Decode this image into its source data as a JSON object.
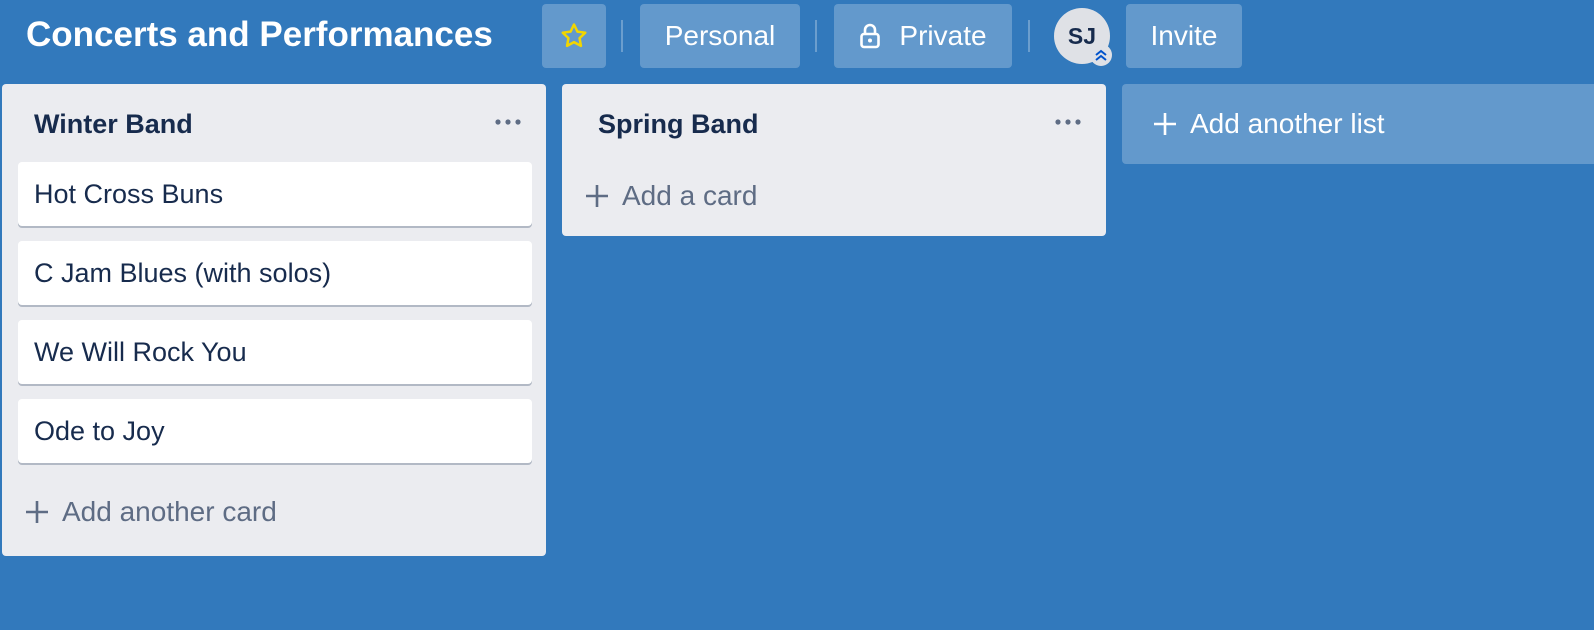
{
  "header": {
    "board_title": "Concerts and Performances",
    "star_icon": "star-icon",
    "personal_label": "Personal",
    "private_label": "Private",
    "lock_icon": "lock-icon",
    "avatar_initials": "SJ",
    "invite_label": "Invite"
  },
  "lists": [
    {
      "title": "Winter Band",
      "cards": [
        "Hot Cross Buns",
        "C Jam Blues (with solos)",
        "We Will Rock You",
        "Ode to Joy"
      ],
      "add_label": "Add another card"
    },
    {
      "title": "Spring Band",
      "cards": [],
      "add_label": "Add a card"
    }
  ],
  "add_list_label": "Add another list",
  "colors": {
    "board_background": "#3279BC",
    "list_background": "#EBECF0",
    "card_text": "#172B4D",
    "muted_text": "#5E6C84",
    "star": "#F2D600"
  }
}
